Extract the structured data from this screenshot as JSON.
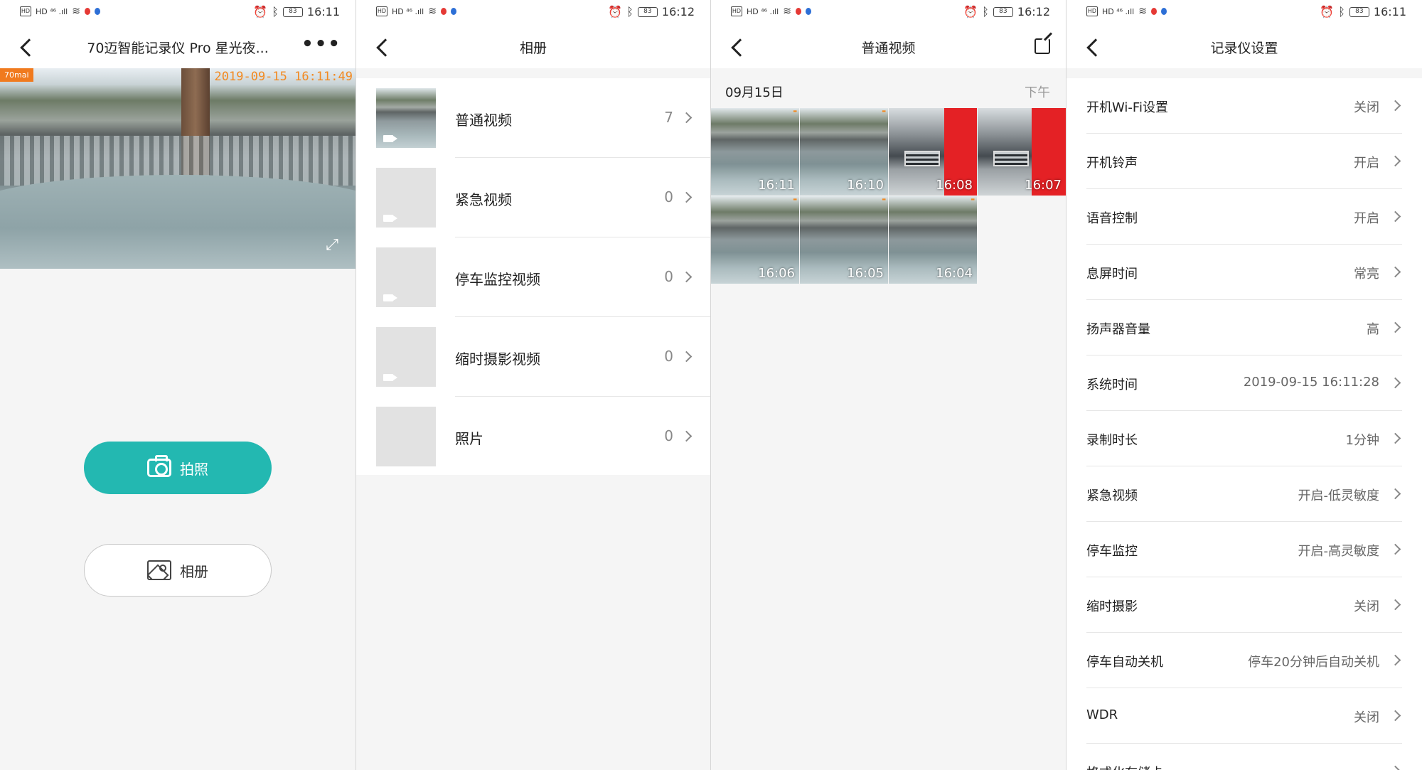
{
  "status_bars": [
    {
      "left_icons": "HD ⁴⁶ .ıll",
      "battery": "83",
      "time": "16:11"
    },
    {
      "left_icons": "HD ⁴⁶ .ıll",
      "battery": "83",
      "time": "16:12"
    },
    {
      "left_icons": "HD ⁴⁶ .ıll",
      "battery": "83",
      "time": "16:12"
    },
    {
      "left_icons": "HD ⁴⁶ .ıll",
      "battery": "83",
      "time": "16:11"
    }
  ],
  "screen1": {
    "title": "70迈智能记录仪 Pro 星光夜...",
    "more_label": "•••",
    "cam_brand": "70mai",
    "cam_timestamp": "2019-09-15 16:11:49",
    "fullscreen_glyph": "⤢",
    "photo_label": "拍照",
    "album_label": "相册",
    "accent_color": "#23b8b1"
  },
  "screen2": {
    "title": "相册",
    "albums": [
      {
        "label": "普通视频",
        "count": "7"
      },
      {
        "label": "紧急视频",
        "count": "0"
      },
      {
        "label": "停车监控视频",
        "count": "0"
      },
      {
        "label": "缩时摄影视频",
        "count": "0"
      },
      {
        "label": "照片",
        "count": "0"
      }
    ]
  },
  "screen3": {
    "title": "普通视频",
    "date": "09月15日",
    "ampm": "下午",
    "videos": [
      {
        "time": "16:11",
        "kind": "street"
      },
      {
        "time": "16:10",
        "kind": "street"
      },
      {
        "time": "16:08",
        "kind": "car-red"
      },
      {
        "time": "16:07",
        "kind": "car-red"
      },
      {
        "time": "16:06",
        "kind": "street"
      },
      {
        "time": "16:05",
        "kind": "street"
      },
      {
        "time": "16:04",
        "kind": "street"
      }
    ]
  },
  "screen4": {
    "title": "记录仪设置",
    "settings": [
      {
        "label": "开机Wi-Fi设置",
        "value": "关闭"
      },
      {
        "label": "开机铃声",
        "value": "开启"
      },
      {
        "label": "语音控制",
        "value": "开启"
      },
      {
        "label": "息屏时间",
        "value": "常亮"
      },
      {
        "label": "扬声器音量",
        "value": "高"
      },
      {
        "label": "系统时间",
        "value": "2019-09-15 16:11:28"
      },
      {
        "label": "录制时长",
        "value": "1分钟"
      },
      {
        "label": "紧急视频",
        "value": "开启-低灵敏度"
      },
      {
        "label": "停车监控",
        "value": "开启-高灵敏度"
      },
      {
        "label": "缩时摄影",
        "value": "关闭"
      },
      {
        "label": "停车自动关机",
        "value": "停车20分钟后自动关机"
      },
      {
        "label": "WDR",
        "value": "关闭"
      },
      {
        "label": "格式化存储卡",
        "value": ""
      }
    ]
  }
}
